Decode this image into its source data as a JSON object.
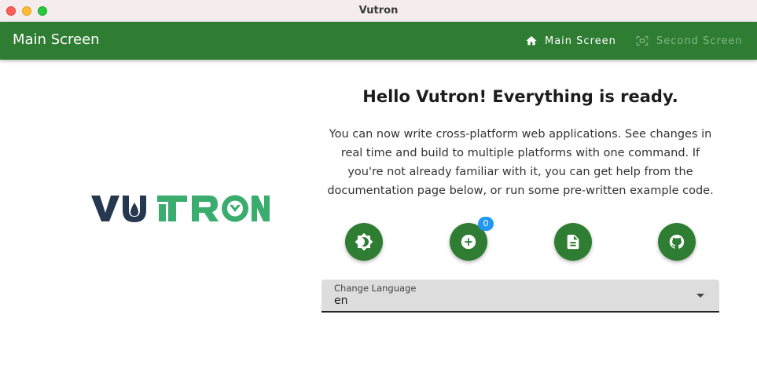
{
  "window": {
    "title": "Vutron"
  },
  "appbar": {
    "title": "Main Screen",
    "nav": [
      {
        "label": "Main Screen",
        "icon": "home-icon",
        "active": true
      },
      {
        "label": "Second Screen",
        "icon": "screenshot-icon",
        "active": false
      }
    ]
  },
  "logo": {
    "text": "VUTRON",
    "colors": {
      "dark": "#263850",
      "accent": "#3aad6e"
    }
  },
  "main": {
    "heading": "Hello Vutron! Everything is ready.",
    "description": "You can now write cross-platform web applications. See changes in real time and build to multiple platforms with one command. If you're not already familiar with it, you can get help from the documentation page below, or run some pre-written example code.",
    "actions": [
      {
        "icon": "brightness-icon"
      },
      {
        "icon": "plus-circle-icon",
        "badge": "0"
      },
      {
        "icon": "document-icon"
      },
      {
        "icon": "github-icon"
      }
    ],
    "language_select": {
      "label": "Change Language",
      "value": "en"
    }
  },
  "colors": {
    "primary": "#2e7d32",
    "badge": "#2196f3"
  }
}
